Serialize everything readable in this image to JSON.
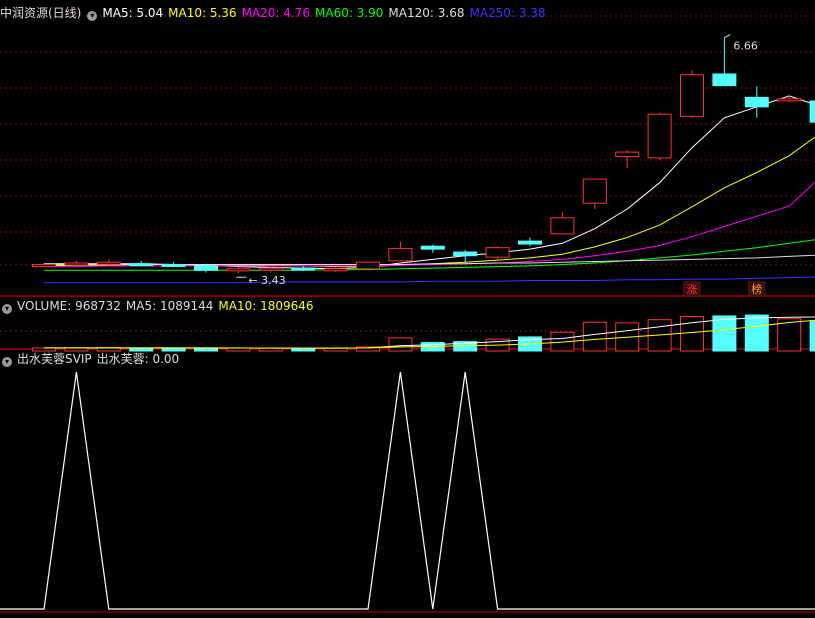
{
  "main_header": {
    "stock": "中润资源(日线)",
    "ma": [
      {
        "label": "MA5: 5.04",
        "color": "#ffffff"
      },
      {
        "label": "MA10: 5.36",
        "color": "#ffff00"
      },
      {
        "label": "MA20: 4.76",
        "color": "#ff00ff"
      },
      {
        "label": "MA60: 3.90",
        "color": "#00ff00"
      },
      {
        "label": "MA120: 3.68",
        "color": "#dddddd"
      },
      {
        "label": "MA250: 3.38",
        "color": "#3333ff"
      }
    ]
  },
  "volume_header": [
    {
      "label": "VOLUME: 968732",
      "color": "#dddddd"
    },
    {
      "label": "MA5: 1089144",
      "color": "#dddddd"
    },
    {
      "label": "MA10: 1809646",
      "color": "#ffff00"
    }
  ],
  "indicator_header": {
    "name": "出水芙蓉SVIP",
    "value": "出水芙蓉: 0.00"
  },
  "chart_data": {
    "type": "candlestick",
    "price_range": [
      3.2,
      6.9
    ],
    "annotations": {
      "high": "6.66",
      "low": "3.43"
    },
    "tags": [
      {
        "index": 20,
        "text": "涨",
        "color": "#ff3333"
      },
      {
        "index": 22,
        "text": "榜",
        "color": "#ff9933"
      }
    ],
    "colors": {
      "up": "#ff3232",
      "down": "#54ffff",
      "grid": "#7a1010",
      "separator": "#b00000"
    },
    "candles": [
      {
        "o": 3.55,
        "h": 3.58,
        "l": 3.52,
        "c": 3.55
      },
      {
        "o": 3.57,
        "h": 3.6,
        "l": 3.53,
        "c": 3.57
      },
      {
        "o": 3.58,
        "h": 3.62,
        "l": 3.53,
        "c": 3.58
      },
      {
        "o": 3.56,
        "h": 3.6,
        "l": 3.52,
        "c": 3.55
      },
      {
        "o": 3.55,
        "h": 3.58,
        "l": 3.51,
        "c": 3.53
      },
      {
        "o": 3.53,
        "h": 3.56,
        "l": 3.44,
        "c": 3.47
      },
      {
        "o": 3.47,
        "h": 3.51,
        "l": 3.43,
        "c": 3.49
      },
      {
        "o": 3.49,
        "h": 3.52,
        "l": 3.44,
        "c": 3.5
      },
      {
        "o": 3.5,
        "h": 3.53,
        "l": 3.46,
        "c": 3.48
      },
      {
        "o": 3.48,
        "h": 3.51,
        "l": 3.45,
        "c": 3.49
      },
      {
        "o": 3.49,
        "h": 3.59,
        "l": 3.47,
        "c": 3.58
      },
      {
        "o": 3.6,
        "h": 3.86,
        "l": 3.59,
        "c": 3.77
      },
      {
        "o": 3.8,
        "h": 3.82,
        "l": 3.71,
        "c": 3.76
      },
      {
        "o": 3.72,
        "h": 3.75,
        "l": 3.57,
        "c": 3.67
      },
      {
        "o": 3.65,
        "h": 3.8,
        "l": 3.61,
        "c": 3.78
      },
      {
        "o": 3.87,
        "h": 3.92,
        "l": 3.8,
        "c": 3.83
      },
      {
        "o": 3.97,
        "h": 4.27,
        "l": 3.97,
        "c": 4.19
      },
      {
        "o": 4.39,
        "h": 4.72,
        "l": 4.31,
        "c": 4.72
      },
      {
        "o": 5.03,
        "h": 5.12,
        "l": 4.87,
        "c": 5.09
      },
      {
        "o": 5.01,
        "h": 5.63,
        "l": 4.98,
        "c": 5.61
      },
      {
        "o": 5.58,
        "h": 6.21,
        "l": 5.56,
        "c": 6.15
      },
      {
        "o": 6.16,
        "h": 6.66,
        "l": 6.0,
        "c": 6.0
      },
      {
        "o": 5.84,
        "h": 5.99,
        "l": 5.56,
        "c": 5.71
      },
      {
        "o": 5.82,
        "h": 5.86,
        "l": 5.77,
        "c": 5.82
      },
      {
        "o": 5.79,
        "h": 5.83,
        "l": 5.5,
        "c": 5.5
      }
    ],
    "ma_series": [
      {
        "name": "MA5",
        "color": "#ffffff",
        "values": [
          3.56,
          3.56,
          3.56,
          3.56,
          3.55,
          3.54,
          3.52,
          3.51,
          3.5,
          3.49,
          3.51,
          3.57,
          3.62,
          3.67,
          3.71,
          3.76,
          3.84,
          4.04,
          4.31,
          4.67,
          5.15,
          5.56,
          5.71,
          5.86,
          5.71
        ]
      },
      {
        "name": "MA10",
        "color": "#ffff00",
        "values": [
          3.53,
          3.54,
          3.54,
          3.55,
          3.55,
          3.55,
          3.54,
          3.54,
          3.53,
          3.52,
          3.52,
          3.54,
          3.56,
          3.58,
          3.61,
          3.64,
          3.69,
          3.79,
          3.92,
          4.09,
          4.34,
          4.6,
          4.81,
          5.04,
          5.36
        ]
      },
      {
        "name": "MA20",
        "color": "#ff00ff",
        "values": [
          3.52,
          3.52,
          3.53,
          3.53,
          3.53,
          3.53,
          3.53,
          3.53,
          3.53,
          3.53,
          3.53,
          3.54,
          3.55,
          3.56,
          3.57,
          3.59,
          3.62,
          3.67,
          3.73,
          3.81,
          3.93,
          4.07,
          4.21,
          4.35,
          4.76
        ]
      },
      {
        "name": "MA60",
        "color": "#00ff00",
        "values": [
          3.47,
          3.47,
          3.47,
          3.47,
          3.47,
          3.47,
          3.47,
          3.47,
          3.47,
          3.48,
          3.48,
          3.49,
          3.5,
          3.51,
          3.52,
          3.53,
          3.55,
          3.57,
          3.6,
          3.64,
          3.68,
          3.73,
          3.78,
          3.84,
          3.9
        ]
      },
      {
        "name": "MA120",
        "color": "#dddddd",
        "values": [
          3.55,
          3.55,
          3.55,
          3.55,
          3.55,
          3.55,
          3.55,
          3.55,
          3.55,
          3.55,
          3.55,
          3.55,
          3.56,
          3.56,
          3.57,
          3.57,
          3.58,
          3.59,
          3.6,
          3.61,
          3.62,
          3.63,
          3.64,
          3.66,
          3.68
        ]
      },
      {
        "name": "MA250",
        "color": "#3333ff",
        "values": [
          3.3,
          3.3,
          3.3,
          3.3,
          3.3,
          3.3,
          3.3,
          3.31,
          3.31,
          3.31,
          3.31,
          3.31,
          3.32,
          3.32,
          3.32,
          3.33,
          3.33,
          3.33,
          3.34,
          3.34,
          3.35,
          3.35,
          3.36,
          3.37,
          3.38
        ]
      }
    ],
    "volume": {
      "max": 1150000,
      "values": [
        95000,
        100000,
        110000,
        95000,
        90000,
        100000,
        95000,
        90000,
        85000,
        90000,
        130000,
        420000,
        270000,
        300000,
        380000,
        450000,
        600000,
        920000,
        900000,
        1000000,
        1100000,
        1120000,
        1150000,
        1030000,
        968732
      ],
      "ma5": [
        100000,
        100000,
        100000,
        100000,
        98000,
        97000,
        96000,
        94000,
        92000,
        92000,
        98000,
        165000,
        200000,
        245000,
        300000,
        364000,
        400000,
        530000,
        650000,
        774000,
        904000,
        1008000,
        1058000,
        1080000,
        1089144
      ],
      "ma10": [
        100000,
        100000,
        100000,
        100000,
        99000,
        98000,
        98000,
        97000,
        95000,
        94000,
        98000,
        130000,
        145000,
        165000,
        190000,
        225000,
        285000,
        370000,
        440000,
        510000,
        590000,
        680000,
        790000,
        910000,
        1000000
      ]
    },
    "indicator": {
      "range": [
        0,
        1
      ],
      "values": [
        0,
        1,
        0,
        0,
        0,
        0,
        0,
        0,
        0,
        0,
        0,
        1,
        0,
        1,
        0,
        0,
        0,
        0,
        0,
        0,
        0,
        0,
        0,
        0,
        0
      ]
    }
  }
}
